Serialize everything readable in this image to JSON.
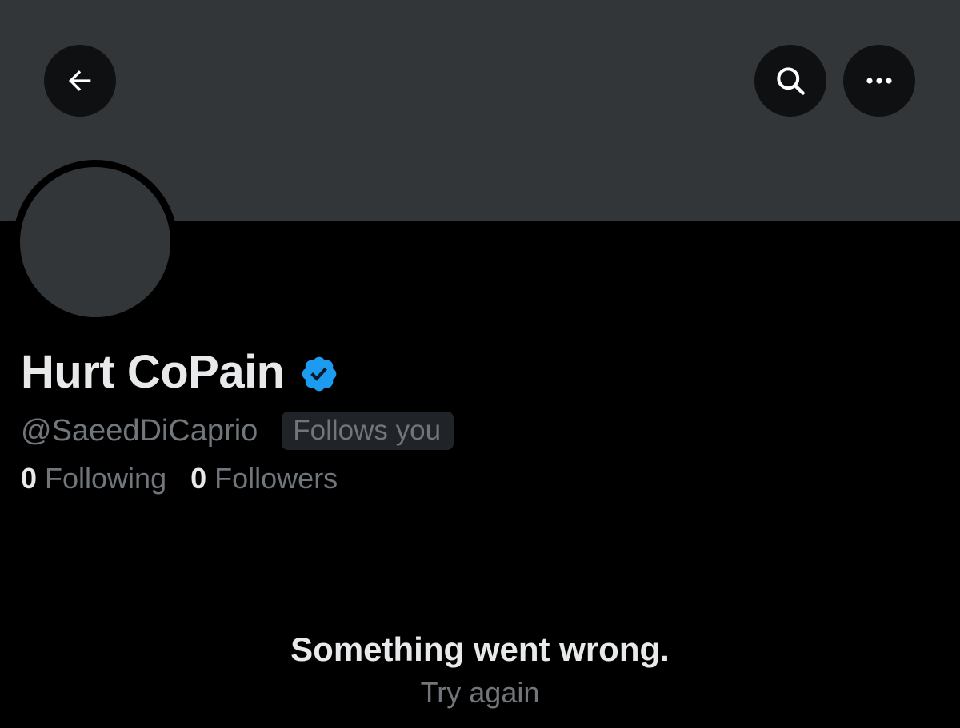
{
  "header": {
    "back_icon": "arrow-left-icon",
    "search_icon": "search-icon",
    "more_icon": "more-horizontal-icon"
  },
  "profile": {
    "display_name": "Hurt CoPain",
    "verified_icon": "verified-badge-icon",
    "handle": "@SaeedDiCaprio",
    "follows_you_label": "Follows you",
    "following_count": "0",
    "following_label": "Following",
    "followers_count": "0",
    "followers_label": "Followers"
  },
  "error": {
    "title": "Something went wrong.",
    "retry_label": "Try again"
  },
  "colors": {
    "background": "#000000",
    "banner": "#333639",
    "primary_text": "#e7e9ea",
    "secondary_text": "#71767b",
    "verified_blue": "#1d9bf0",
    "badge_bg": "#202327",
    "button_bg": "#0f1012"
  }
}
